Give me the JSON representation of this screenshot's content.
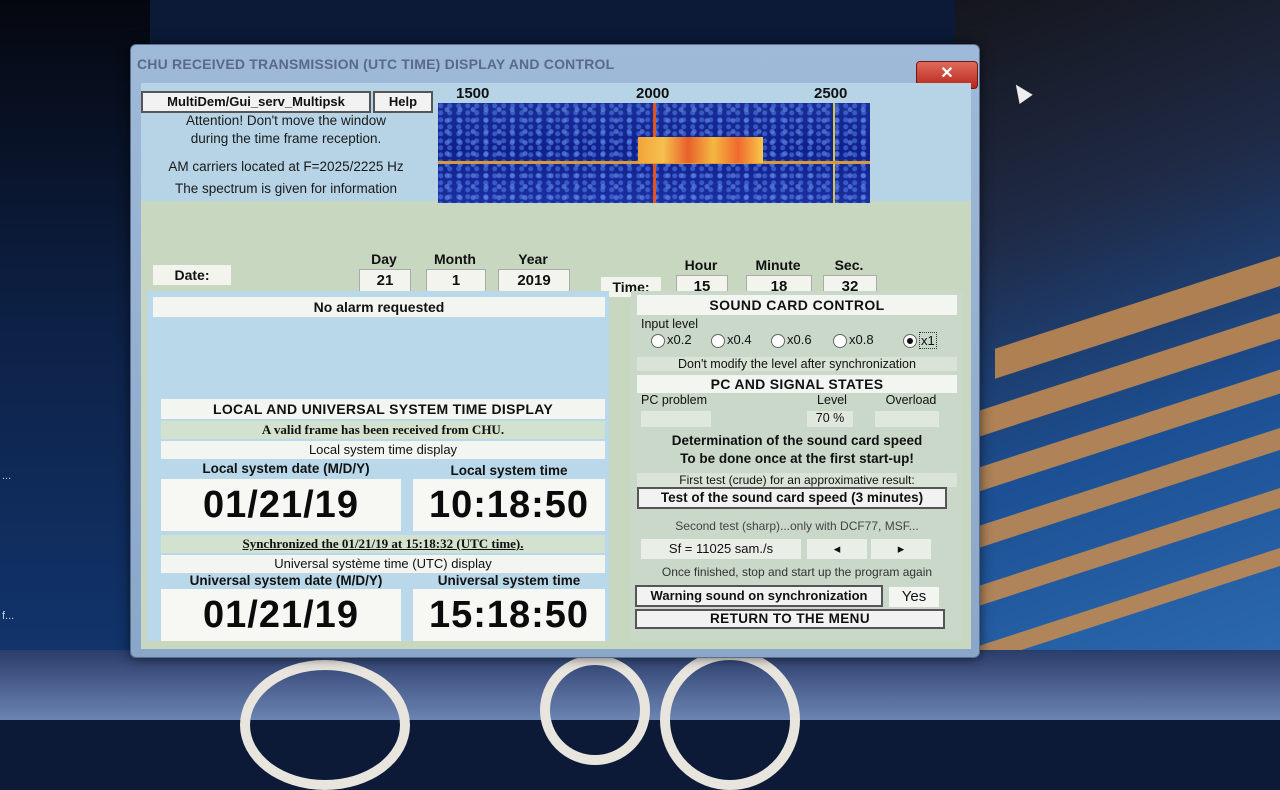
{
  "window": {
    "title": "CHU RECEIVED TRANSMISSION (UTC TIME) DISPLAY AND CONTROL",
    "close_glyph": "✕"
  },
  "top": {
    "menu_button": "MultiDem/Gui_serv_Multipsk",
    "help_button": "Help",
    "attention_line1": "Attention! Don't move the window",
    "attention_line2": "during the time frame reception.",
    "carriers": "AM carriers located at F=2025/2225 Hz",
    "spectrum_info": "The spectrum is given for information",
    "freq_ticks": [
      "1500",
      "2000",
      "2500"
    ]
  },
  "datetime": {
    "date_label": "Date:",
    "time_label": "Time:",
    "day_label": "Day",
    "day": "21",
    "month_label": "Month",
    "month": "1",
    "year_label": "Year",
    "year": "2019",
    "hour_label": "Hour",
    "hour": "15",
    "minute_label": "Minute",
    "minute": "18",
    "sec_label": "Sec.",
    "sec": "32"
  },
  "left": {
    "alarm": "No alarm requested",
    "section_title": "LOCAL AND UNIVERSAL SYSTEM TIME DISPLAY",
    "valid_frame": "A valid frame has been received from CHU.",
    "local_display": "Local system time display",
    "local_date_label": "Local system date (M/D/Y)",
    "local_time_label": "Local system time",
    "local_date": "01/21/19",
    "local_time": "10:18:50",
    "synchronized": "Synchronized the 01/21/19 at 15:18:32 (UTC time).",
    "utc_display": "Universal  système time (UTC) display",
    "utc_date_label": "Universal system date (M/D/Y)",
    "utc_time_label": "Universal system time",
    "utc_date": "01/21/19",
    "utc_time": "15:18:50"
  },
  "right": {
    "sound_title": "SOUND CARD CONTROL",
    "input_level": "Input level",
    "levels": [
      "x0.2",
      "x0.4",
      "x0.6",
      "x0.8",
      "x1"
    ],
    "selected_level": "x1",
    "dont_modify": "Don't modify the level after synchronization",
    "pc_states": "PC AND SIGNAL STATES",
    "pc_problem": "PC problem",
    "level_label": "Level",
    "overload": "Overload",
    "level_value": "70 %",
    "det_title1": "Determination of the sound card speed",
    "det_title2": "To be done once at the first start-up!",
    "first_test": "First test (crude) for an approximative result:",
    "test_button": "Test of the sound card speed (3 minutes)",
    "second_test": "Second test (sharp)...only with DCF77, MSF...",
    "sf_value": "Sf = 11025 sam./s",
    "left_arrow": "◂",
    "right_arrow": "▸",
    "once_finished": "Once finished, stop and start up the program again",
    "warning_button": "Warning sound on synchronization",
    "yes": "Yes",
    "return_menu": "RETURN TO THE MENU"
  },
  "desktop": {
    "edge1": "...",
    "edge2": "f..."
  }
}
